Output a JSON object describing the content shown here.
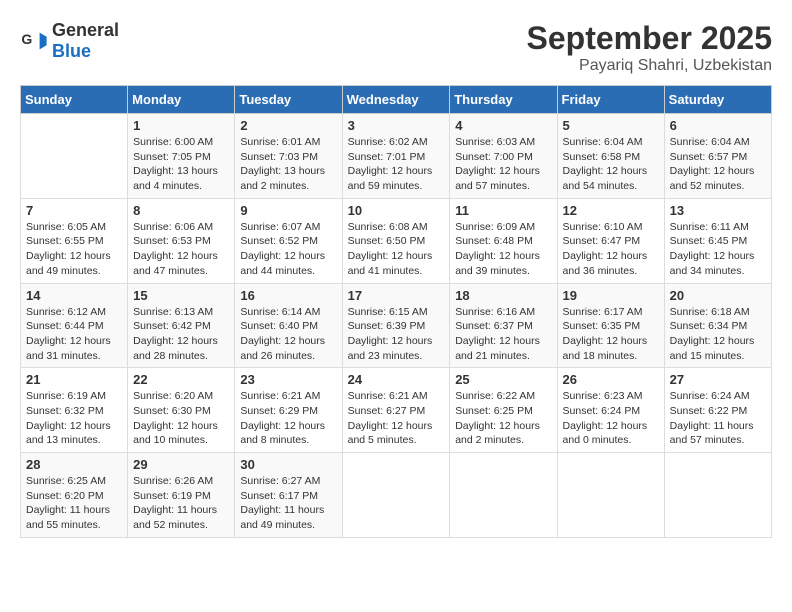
{
  "header": {
    "logo_general": "General",
    "logo_blue": "Blue",
    "month": "September 2025",
    "location": "Payariq Shahri, Uzbekistan"
  },
  "days_of_week": [
    "Sunday",
    "Monday",
    "Tuesday",
    "Wednesday",
    "Thursday",
    "Friday",
    "Saturday"
  ],
  "weeks": [
    [
      {
        "day": "",
        "info": ""
      },
      {
        "day": "1",
        "info": "Sunrise: 6:00 AM\nSunset: 7:05 PM\nDaylight: 13 hours\nand 4 minutes."
      },
      {
        "day": "2",
        "info": "Sunrise: 6:01 AM\nSunset: 7:03 PM\nDaylight: 13 hours\nand 2 minutes."
      },
      {
        "day": "3",
        "info": "Sunrise: 6:02 AM\nSunset: 7:01 PM\nDaylight: 12 hours\nand 59 minutes."
      },
      {
        "day": "4",
        "info": "Sunrise: 6:03 AM\nSunset: 7:00 PM\nDaylight: 12 hours\nand 57 minutes."
      },
      {
        "day": "5",
        "info": "Sunrise: 6:04 AM\nSunset: 6:58 PM\nDaylight: 12 hours\nand 54 minutes."
      },
      {
        "day": "6",
        "info": "Sunrise: 6:04 AM\nSunset: 6:57 PM\nDaylight: 12 hours\nand 52 minutes."
      }
    ],
    [
      {
        "day": "7",
        "info": "Sunrise: 6:05 AM\nSunset: 6:55 PM\nDaylight: 12 hours\nand 49 minutes."
      },
      {
        "day": "8",
        "info": "Sunrise: 6:06 AM\nSunset: 6:53 PM\nDaylight: 12 hours\nand 47 minutes."
      },
      {
        "day": "9",
        "info": "Sunrise: 6:07 AM\nSunset: 6:52 PM\nDaylight: 12 hours\nand 44 minutes."
      },
      {
        "day": "10",
        "info": "Sunrise: 6:08 AM\nSunset: 6:50 PM\nDaylight: 12 hours\nand 41 minutes."
      },
      {
        "day": "11",
        "info": "Sunrise: 6:09 AM\nSunset: 6:48 PM\nDaylight: 12 hours\nand 39 minutes."
      },
      {
        "day": "12",
        "info": "Sunrise: 6:10 AM\nSunset: 6:47 PM\nDaylight: 12 hours\nand 36 minutes."
      },
      {
        "day": "13",
        "info": "Sunrise: 6:11 AM\nSunset: 6:45 PM\nDaylight: 12 hours\nand 34 minutes."
      }
    ],
    [
      {
        "day": "14",
        "info": "Sunrise: 6:12 AM\nSunset: 6:44 PM\nDaylight: 12 hours\nand 31 minutes."
      },
      {
        "day": "15",
        "info": "Sunrise: 6:13 AM\nSunset: 6:42 PM\nDaylight: 12 hours\nand 28 minutes."
      },
      {
        "day": "16",
        "info": "Sunrise: 6:14 AM\nSunset: 6:40 PM\nDaylight: 12 hours\nand 26 minutes."
      },
      {
        "day": "17",
        "info": "Sunrise: 6:15 AM\nSunset: 6:39 PM\nDaylight: 12 hours\nand 23 minutes."
      },
      {
        "day": "18",
        "info": "Sunrise: 6:16 AM\nSunset: 6:37 PM\nDaylight: 12 hours\nand 21 minutes."
      },
      {
        "day": "19",
        "info": "Sunrise: 6:17 AM\nSunset: 6:35 PM\nDaylight: 12 hours\nand 18 minutes."
      },
      {
        "day": "20",
        "info": "Sunrise: 6:18 AM\nSunset: 6:34 PM\nDaylight: 12 hours\nand 15 minutes."
      }
    ],
    [
      {
        "day": "21",
        "info": "Sunrise: 6:19 AM\nSunset: 6:32 PM\nDaylight: 12 hours\nand 13 minutes."
      },
      {
        "day": "22",
        "info": "Sunrise: 6:20 AM\nSunset: 6:30 PM\nDaylight: 12 hours\nand 10 minutes."
      },
      {
        "day": "23",
        "info": "Sunrise: 6:21 AM\nSunset: 6:29 PM\nDaylight: 12 hours\nand 8 minutes."
      },
      {
        "day": "24",
        "info": "Sunrise: 6:21 AM\nSunset: 6:27 PM\nDaylight: 12 hours\nand 5 minutes."
      },
      {
        "day": "25",
        "info": "Sunrise: 6:22 AM\nSunset: 6:25 PM\nDaylight: 12 hours\nand 2 minutes."
      },
      {
        "day": "26",
        "info": "Sunrise: 6:23 AM\nSunset: 6:24 PM\nDaylight: 12 hours\nand 0 minutes."
      },
      {
        "day": "27",
        "info": "Sunrise: 6:24 AM\nSunset: 6:22 PM\nDaylight: 11 hours\nand 57 minutes."
      }
    ],
    [
      {
        "day": "28",
        "info": "Sunrise: 6:25 AM\nSunset: 6:20 PM\nDaylight: 11 hours\nand 55 minutes."
      },
      {
        "day": "29",
        "info": "Sunrise: 6:26 AM\nSunset: 6:19 PM\nDaylight: 11 hours\nand 52 minutes."
      },
      {
        "day": "30",
        "info": "Sunrise: 6:27 AM\nSunset: 6:17 PM\nDaylight: 11 hours\nand 49 minutes."
      },
      {
        "day": "",
        "info": ""
      },
      {
        "day": "",
        "info": ""
      },
      {
        "day": "",
        "info": ""
      },
      {
        "day": "",
        "info": ""
      }
    ]
  ]
}
